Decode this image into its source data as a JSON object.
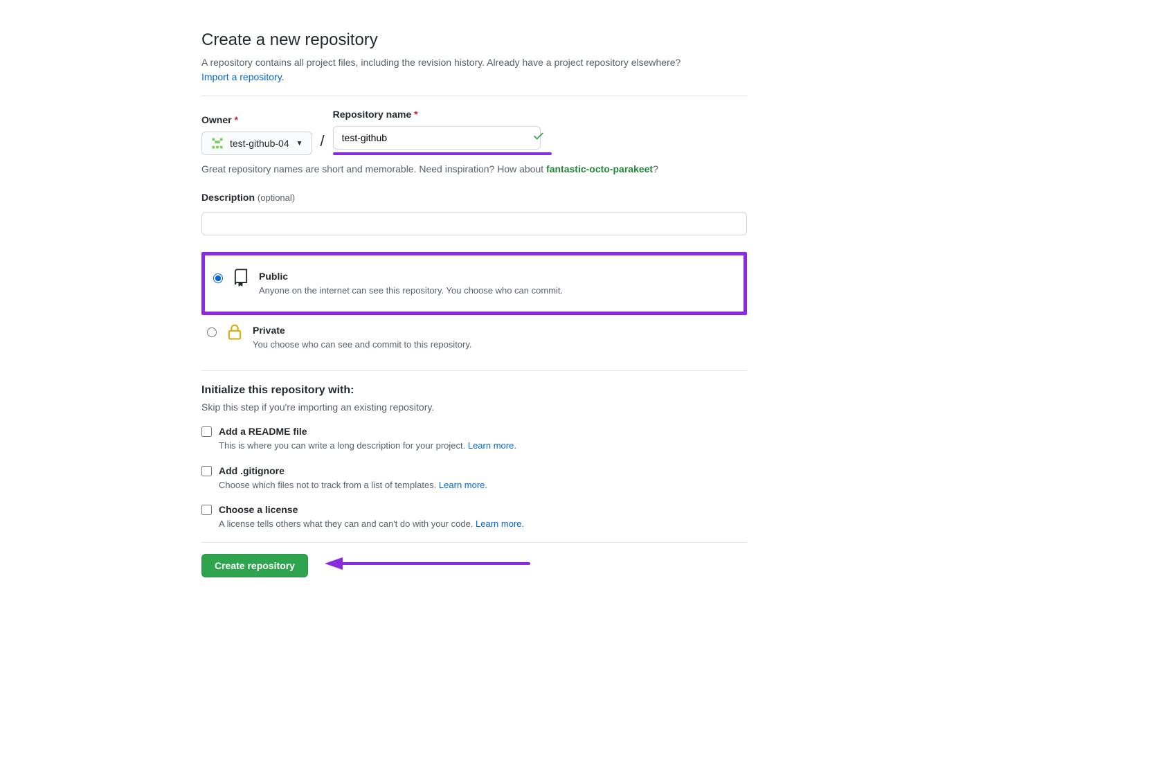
{
  "header": {
    "title": "Create a new repository",
    "subtitle": "A repository contains all project files, including the revision history. Already have a project repository elsewhere?",
    "import_link": "Import a repository."
  },
  "owner": {
    "label": "Owner",
    "value": "test-github-04"
  },
  "repo_name": {
    "label": "Repository name",
    "value": "test-github"
  },
  "hint": {
    "text": "Great repository names are short and memorable. Need inspiration? How about ",
    "suggestion": "fantastic-octo-parakeet",
    "trail": "?"
  },
  "description": {
    "label": "Description",
    "optional": "(optional)",
    "value": ""
  },
  "visibility": {
    "public": {
      "title": "Public",
      "desc": "Anyone on the internet can see this repository. You choose who can commit."
    },
    "private": {
      "title": "Private",
      "desc": "You choose who can see and commit to this repository."
    }
  },
  "initialize": {
    "heading": "Initialize this repository with:",
    "subtext": "Skip this step if you're importing an existing repository.",
    "readme": {
      "title": "Add a README file",
      "desc": "This is where you can write a long description for your project. ",
      "link": "Learn more."
    },
    "gitignore": {
      "title": "Add .gitignore",
      "desc": "Choose which files not to track from a list of templates. ",
      "link": "Learn more."
    },
    "license": {
      "title": "Choose a license",
      "desc": "A license tells others what they can and can't do with your code. ",
      "link": "Learn more."
    }
  },
  "submit": {
    "label": "Create repository"
  }
}
